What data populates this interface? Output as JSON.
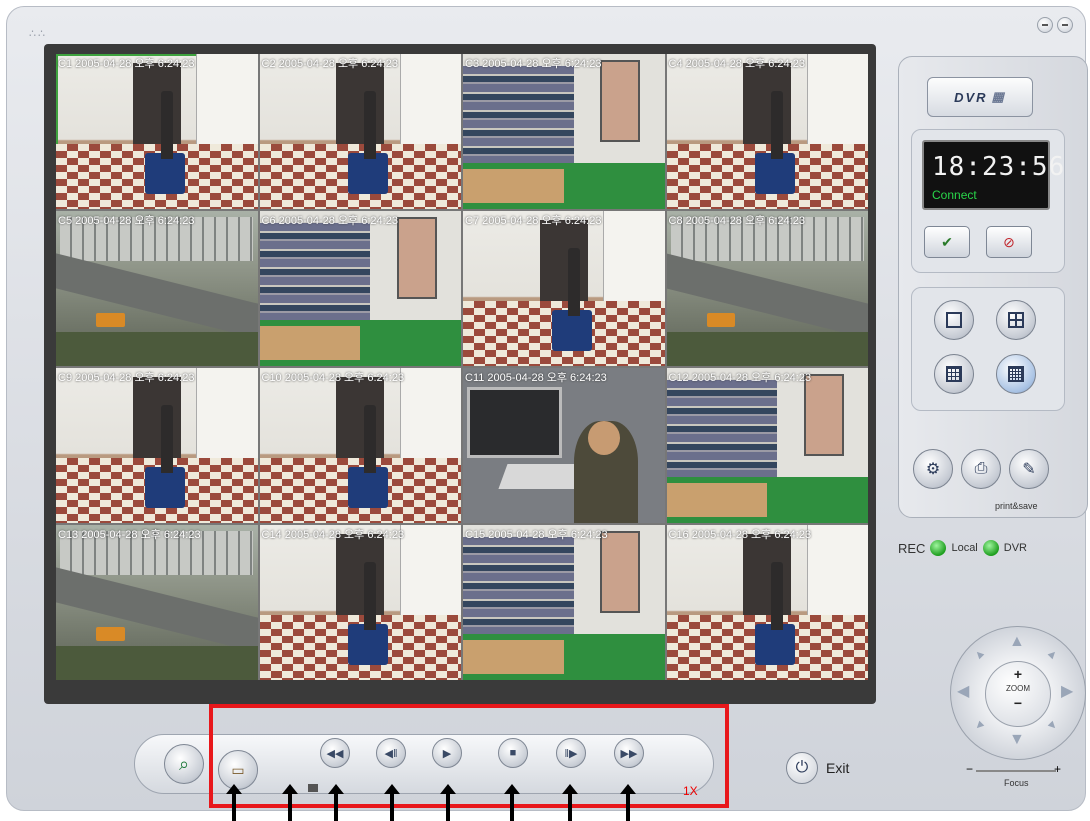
{
  "cameras": [
    {
      "label": "C1  2005-04-28 오후 6:24:23",
      "scene": "door",
      "selected": true
    },
    {
      "label": "C2  2005-04-28 오후 6:24:23",
      "scene": "door"
    },
    {
      "label": "C3  2005-04-28 오후 6:24:23",
      "scene": "shelf"
    },
    {
      "label": "C4  2005-04-28 오후 6:24:23",
      "scene": "door"
    },
    {
      "label": "C5  2005-04-28 오후 6:24:23",
      "scene": "street"
    },
    {
      "label": "C6  2005-04-28 오후 6:24:23",
      "scene": "shelf"
    },
    {
      "label": "C7  2005-04-28 오후 6:24:23",
      "scene": "door"
    },
    {
      "label": "C8  2005-04-28 오후 6:24:23",
      "scene": "street"
    },
    {
      "label": "C9  2005-04-28 오후 6:24:23",
      "scene": "door"
    },
    {
      "label": "C10  2005-04-28 오후 6:24:23",
      "scene": "door"
    },
    {
      "label": "C11  2005-04-28 오후 6:24:23",
      "scene": "office"
    },
    {
      "label": "C12  2005-04-28 오후 6:24:23",
      "scene": "shelf"
    },
    {
      "label": "C13  2005-04-28 오후 6:24:23",
      "scene": "street"
    },
    {
      "label": "C14  2005-04-28 오후 6:24:23",
      "scene": "door"
    },
    {
      "label": "C15  2005-04-28 오후 6:24:23",
      "scene": "shelf"
    },
    {
      "label": "C16  2005-04-28 오후 6:24:23",
      "scene": "door"
    }
  ],
  "panel": {
    "dvr_label": "DVR",
    "clock": "18:23:56",
    "status": "Connect",
    "print_save_label": "print&save"
  },
  "rec": {
    "label": "REC",
    "local": "Local",
    "dvr": "DVR",
    "led_color": "#1e9e1e"
  },
  "ptz": {
    "zoom_label": "ZOOM",
    "plus": "+",
    "minus": "−",
    "focus_label": "Focus",
    "focus_minus": "−",
    "focus_plus": "+"
  },
  "playback": {
    "speed": "1X",
    "buttons": [
      {
        "name": "rewind-button",
        "icon": "◀◀"
      },
      {
        "name": "step-back-button",
        "icon": "◀‖"
      },
      {
        "name": "play-button",
        "icon": "▶"
      },
      {
        "name": "stop-button",
        "icon": "■"
      },
      {
        "name": "step-forward-button",
        "icon": "‖▶"
      },
      {
        "name": "fast-forward-button",
        "icon": "▶▶"
      }
    ]
  },
  "exit_label": "Exit",
  "highlight_color": "#e8171b"
}
